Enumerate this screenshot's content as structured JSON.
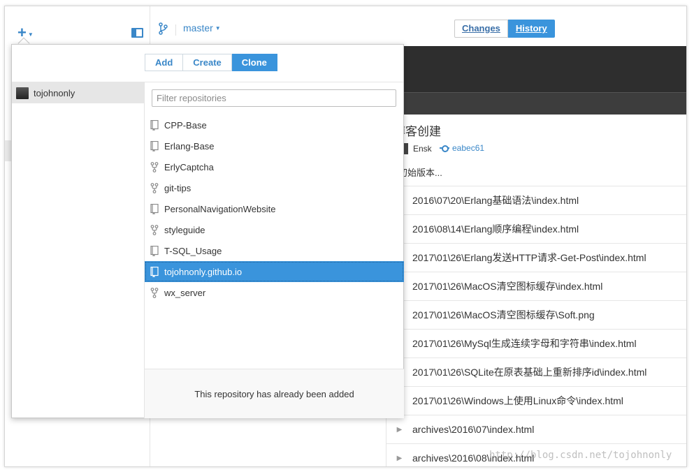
{
  "toolbar": {
    "add_icon": "plus-icon",
    "branch": "master",
    "tabs": [
      {
        "label": "Changes",
        "active": false
      },
      {
        "label": "History",
        "active": true
      }
    ]
  },
  "commit": {
    "title": "博客创建",
    "author": "Ensk",
    "sha": "eabec61",
    "description": "初始版本..."
  },
  "files": [
    "2016\\07\\20\\Erlang基础语法\\index.html",
    "2016\\08\\14\\Erlang顺序编程\\index.html",
    "2017\\01\\26\\Erlang发送HTTP请求-Get-Post\\index.html",
    "2017\\01\\26\\MacOS清空图标缓存\\index.html",
    "2017\\01\\26\\MacOS清空图标缓存\\Soft.png",
    "2017\\01\\26\\MySql生成连续字母和字符串\\index.html",
    "2017\\01\\26\\SQLite在原表基础上重新排序id\\index.html",
    "2017\\01\\26\\Windows上使用Linux命令\\index.html",
    "archives\\2016\\07\\index.html",
    "archives\\2016\\08\\index.html"
  ],
  "popover": {
    "tabs": [
      {
        "label": "Add",
        "active": false
      },
      {
        "label": "Create",
        "active": false
      },
      {
        "label": "Clone",
        "active": true
      }
    ],
    "account": "tojohnonly",
    "filter_placeholder": "Filter repositories",
    "repos": [
      {
        "name": "CPP-Base",
        "icon": "repo-icon",
        "selected": false
      },
      {
        "name": "Erlang-Base",
        "icon": "repo-icon",
        "selected": false
      },
      {
        "name": "ErlyCaptcha",
        "icon": "fork-icon",
        "selected": false
      },
      {
        "name": "git-tips",
        "icon": "fork-icon",
        "selected": false
      },
      {
        "name": "PersonalNavigationWebsite",
        "icon": "repo-icon",
        "selected": false
      },
      {
        "name": "styleguide",
        "icon": "fork-icon",
        "selected": false
      },
      {
        "name": "T-SQL_Usage",
        "icon": "repo-icon",
        "selected": false
      },
      {
        "name": "tojohnonly.github.io",
        "icon": "repo-icon",
        "selected": true
      },
      {
        "name": "wx_server",
        "icon": "fork-icon",
        "selected": false
      }
    ],
    "footer": "This repository has already been added"
  },
  "watermark": "http://blog.csdn.net/tojohnonly"
}
